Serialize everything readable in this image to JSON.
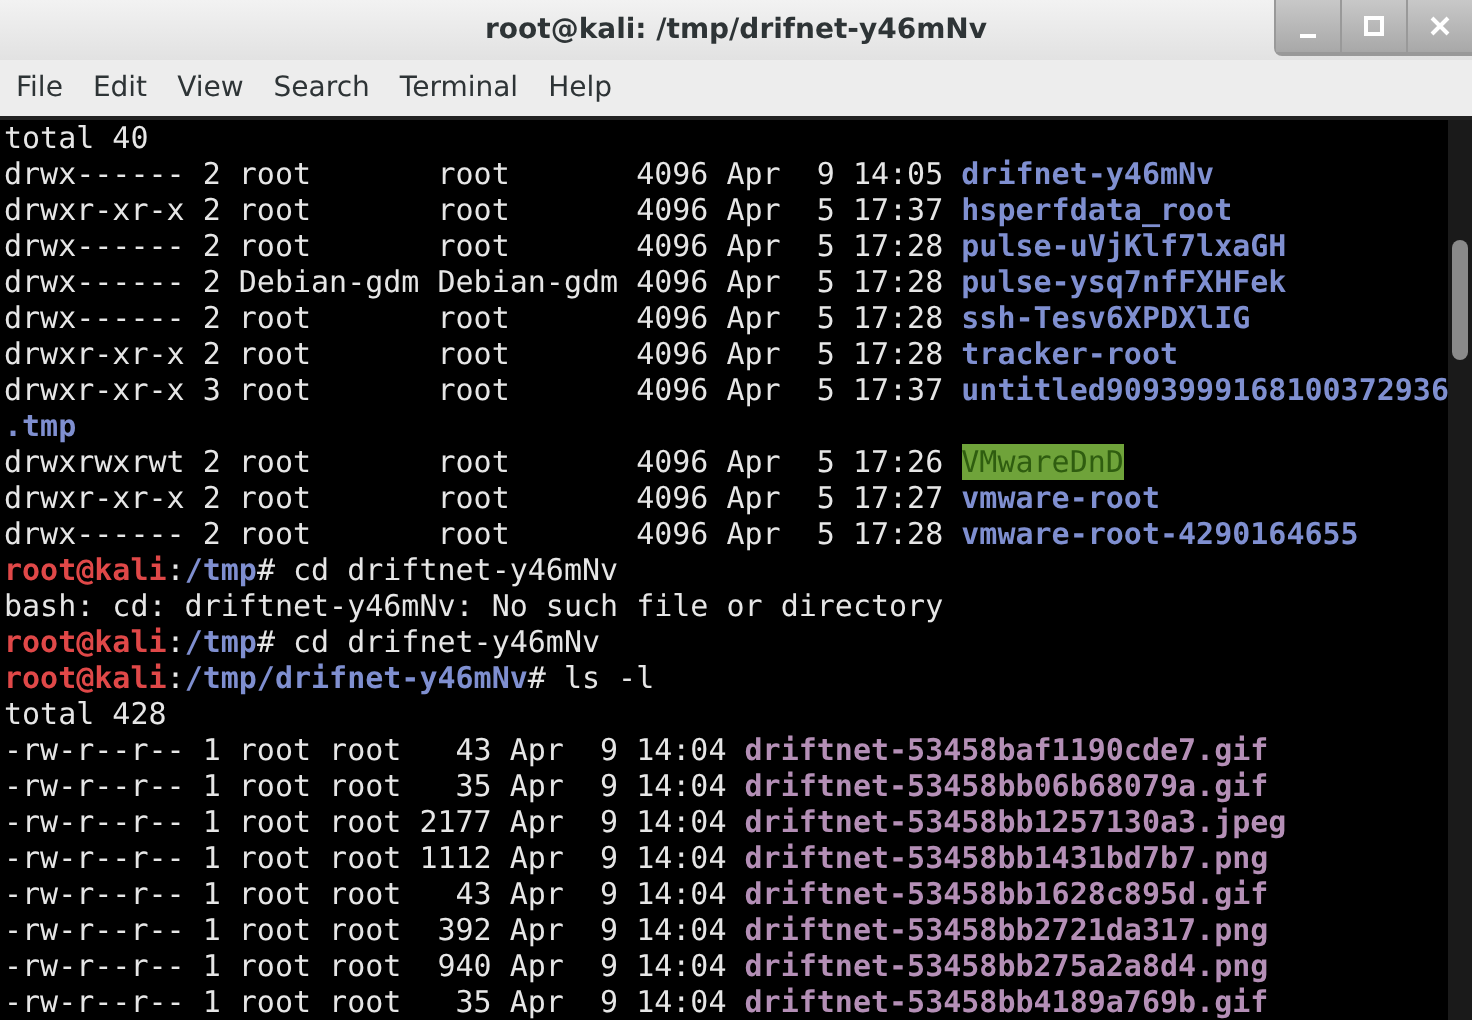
{
  "window": {
    "title": "root@kali: /tmp/drifnet-y46mNv"
  },
  "menu": [
    "File",
    "Edit",
    "View",
    "Search",
    "Terminal",
    "Help"
  ],
  "terminal": {
    "lines": [
      [
        {
          "kind": "plain",
          "text": "total 40"
        }
      ],
      [
        {
          "kind": "plain",
          "text": "drwx------ 2 root       root       4096 Apr  9 14:05 "
        },
        {
          "kind": "dir",
          "text": "drifnet-y46mNv"
        }
      ],
      [
        {
          "kind": "plain",
          "text": "drwxr-xr-x 2 root       root       4096 Apr  5 17:37 "
        },
        {
          "kind": "dir",
          "text": "hsperfdata_root"
        }
      ],
      [
        {
          "kind": "plain",
          "text": "drwx------ 2 root       root       4096 Apr  5 17:28 "
        },
        {
          "kind": "dir",
          "text": "pulse-uVjKlf7lxaGH"
        }
      ],
      [
        {
          "kind": "plain",
          "text": "drwx------ 2 Debian-gdm Debian-gdm 4096 Apr  5 17:28 "
        },
        {
          "kind": "dir",
          "text": "pulse-ysq7nfFXHFek"
        }
      ],
      [
        {
          "kind": "plain",
          "text": "drwx------ 2 root       root       4096 Apr  5 17:28 "
        },
        {
          "kind": "dir",
          "text": "ssh-Tesv6XPDXlIG"
        }
      ],
      [
        {
          "kind": "plain",
          "text": "drwxr-xr-x 2 root       root       4096 Apr  5 17:28 "
        },
        {
          "kind": "dir",
          "text": "tracker-root"
        }
      ],
      [
        {
          "kind": "plain",
          "text": "drwxr-xr-x 3 root       root       4096 Apr  5 17:37 "
        },
        {
          "kind": "dir",
          "text": "untitled9093999168100372936"
        }
      ],
      [
        {
          "kind": "dir",
          "text": ".tmp"
        }
      ],
      [
        {
          "kind": "plain",
          "text": "drwxrwxrwt 2 root       root       4096 Apr  5 17:26 "
        },
        {
          "kind": "sticky",
          "text": "VMwareDnD"
        }
      ],
      [
        {
          "kind": "plain",
          "text": "drwxr-xr-x 2 root       root       4096 Apr  5 17:27 "
        },
        {
          "kind": "dir",
          "text": "vmware-root"
        }
      ],
      [
        {
          "kind": "plain",
          "text": "drwx------ 2 root       root       4096 Apr  5 17:28 "
        },
        {
          "kind": "dir",
          "text": "vmware-root-4290164655"
        }
      ],
      [
        {
          "kind": "user",
          "text": "root@kali"
        },
        {
          "kind": "plain",
          "text": ":"
        },
        {
          "kind": "path",
          "text": "/tmp"
        },
        {
          "kind": "plain",
          "text": "# cd driftnet-y46mNv"
        }
      ],
      [
        {
          "kind": "plain",
          "text": "bash: cd: driftnet-y46mNv: No such file or directory"
        }
      ],
      [
        {
          "kind": "user",
          "text": "root@kali"
        },
        {
          "kind": "plain",
          "text": ":"
        },
        {
          "kind": "path",
          "text": "/tmp"
        },
        {
          "kind": "plain",
          "text": "# cd drifnet-y46mNv"
        }
      ],
      [
        {
          "kind": "user",
          "text": "root@kali"
        },
        {
          "kind": "plain",
          "text": ":"
        },
        {
          "kind": "path",
          "text": "/tmp/drifnet-y46mNv"
        },
        {
          "kind": "plain",
          "text": "# ls -l"
        }
      ],
      [
        {
          "kind": "plain",
          "text": "total 428"
        }
      ],
      [
        {
          "kind": "plain",
          "text": "-rw-r--r-- 1 root root   43 Apr  9 14:04 "
        },
        {
          "kind": "image",
          "text": "driftnet-53458baf1190cde7.gif"
        }
      ],
      [
        {
          "kind": "plain",
          "text": "-rw-r--r-- 1 root root   35 Apr  9 14:04 "
        },
        {
          "kind": "image",
          "text": "driftnet-53458bb06b68079a.gif"
        }
      ],
      [
        {
          "kind": "plain",
          "text": "-rw-r--r-- 1 root root 2177 Apr  9 14:04 "
        },
        {
          "kind": "image",
          "text": "driftnet-53458bb1257130a3.jpeg"
        }
      ],
      [
        {
          "kind": "plain",
          "text": "-rw-r--r-- 1 root root 1112 Apr  9 14:04 "
        },
        {
          "kind": "image",
          "text": "driftnet-53458bb1431bd7b7.png"
        }
      ],
      [
        {
          "kind": "plain",
          "text": "-rw-r--r-- 1 root root   43 Apr  9 14:04 "
        },
        {
          "kind": "image",
          "text": "driftnet-53458bb1628c895d.gif"
        }
      ],
      [
        {
          "kind": "plain",
          "text": "-rw-r--r-- 1 root root  392 Apr  9 14:04 "
        },
        {
          "kind": "image",
          "text": "driftnet-53458bb2721da317.png"
        }
      ],
      [
        {
          "kind": "plain",
          "text": "-rw-r--r-- 1 root root  940 Apr  9 14:04 "
        },
        {
          "kind": "image",
          "text": "driftnet-53458bb275a2a8d4.png"
        }
      ],
      [
        {
          "kind": "plain",
          "text": "-rw-r--r-- 1 root root   35 Apr  9 14:04 "
        },
        {
          "kind": "image",
          "text": "driftnet-53458bb4189a769b.gif"
        }
      ]
    ]
  }
}
